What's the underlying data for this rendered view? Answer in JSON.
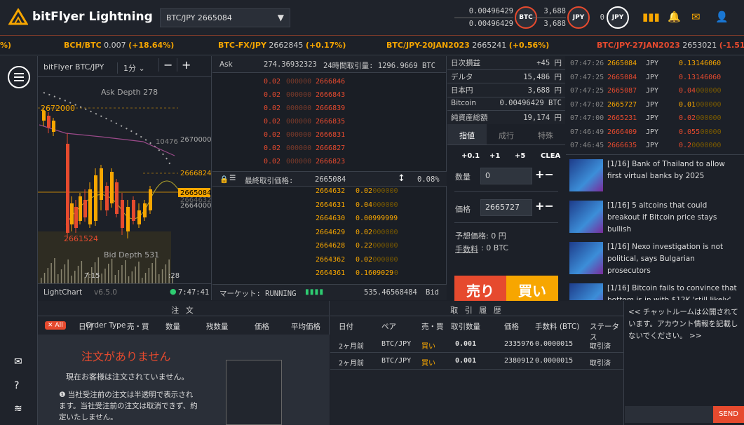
{
  "app": {
    "logo": "bitFlyer Lightning"
  },
  "header": {
    "pair_select": "BTC/JPY 2665084",
    "btc_bal_1": "0.00496429",
    "btc_bal_2": "0.00496429",
    "btc_label": "BTC",
    "jpy_bal_1": "3,688",
    "jpy_bal_2": "3,688",
    "jpy_label": "JPY",
    "jpy2_val": "0",
    "jpy2_label": "JPY"
  },
  "ticker": [
    {
      "symbol": "BCH/BTC",
      "price": "0.007",
      "change": "(+18.64%)",
      "dir": "up"
    },
    {
      "symbol": "BTC-FX/JPY",
      "price": "2662845",
      "change": "(+0.17%)",
      "dir": "up"
    },
    {
      "symbol": "BTC/JPY-20JAN2023",
      "price": "2665241",
      "change": "(+0.56%)",
      "dir": "up"
    },
    {
      "symbol": "BTC/JPY-27JAN2023",
      "price": "2653021",
      "change": "(-1.51%)",
      "dir": "dn"
    }
  ],
  "ticker_lead": "%)",
  "chart": {
    "pair": "bitFlyer BTC/JPY",
    "interval": "1分",
    "ask_depth": "Ask Depth 278",
    "bid_depth": "Bid Depth 531",
    "price_high": "2672000",
    "price_low": "2661524",
    "axis_1": "2670000",
    "axis_2": "2666824",
    "axis_3": "2665084",
    "axis_4": "2664000",
    "axis_4b": "2664632",
    "side_label": "10476",
    "time_label": "7:15",
    "time_label_2": ":28",
    "footer_brand": "LightChart",
    "footer_version": "v6.5.0",
    "footer_time": "7:47:41"
  },
  "book": {
    "ask_label": "Ask",
    "ask_total": "274.36932323",
    "volume_label": "24時間取引量: 1296.9669 BTC",
    "asks": [
      {
        "size": "0.02",
        "sizeb": "000000",
        "price": "2666846"
      },
      {
        "size": "0.02",
        "sizeb": "000000",
        "price": "2666843"
      },
      {
        "size": "0.02",
        "sizeb": "000000",
        "price": "2666839"
      },
      {
        "size": "0.02",
        "sizeb": "000000",
        "price": "2666835"
      },
      {
        "size": "0.02",
        "sizeb": "000000",
        "price": "2666831"
      },
      {
        "size": "0.02",
        "sizeb": "000000",
        "price": "2666827"
      },
      {
        "size": "0.02",
        "sizeb": "000000",
        "price": "2666823"
      }
    ],
    "last_label": "最終取引価格:",
    "last_price": "2665084",
    "spread": "0.08%",
    "bids": [
      {
        "price": "2664632",
        "size": "0.02",
        "sizeb": "000000"
      },
      {
        "price": "2664631",
        "size": "0.04",
        "sizeb": "000000"
      },
      {
        "price": "2664630",
        "size": "0.00999999",
        "sizeb": ""
      },
      {
        "price": "2664629",
        "size": "0.02",
        "sizeb": "000000"
      },
      {
        "price": "2664628",
        "size": "0.22",
        "sizeb": "000000"
      },
      {
        "price": "2664362",
        "size": "0.02",
        "sizeb": "000000"
      },
      {
        "price": "2664361",
        "size": "0.1609029",
        "sizeb": "0"
      }
    ],
    "market_label": "マーケット: RUNNING",
    "bid_total": "535.46568484",
    "bid_label": "Bid"
  },
  "account": [
    {
      "label": "日次損益",
      "value": "+45 円"
    },
    {
      "label": "デルタ",
      "value": "15,486 円"
    },
    {
      "label": "日本円",
      "value": "3,688 円"
    },
    {
      "label": "Bitcoin",
      "value": "0.00496429 BTC"
    },
    {
      "label": "純資産総額",
      "value": "19,174 円"
    }
  ],
  "order": {
    "tabs": [
      "指値",
      "成行",
      "特殊"
    ],
    "quick": [
      "+0.1",
      "+1",
      "+5",
      "CLEA"
    ],
    "qty_label": "数量",
    "qty_value": "0",
    "price_label": "価格",
    "price_value": "2665727",
    "est_label": "予想価格: 0 円",
    "fee_label": "手数料",
    "fee_value": ": 0 BTC",
    "sell": "売り",
    "buy": "買い"
  },
  "trades": [
    {
      "time": "07:47:26",
      "price": "2665084",
      "cur": "JPY",
      "size": "0.13146060",
      "sizeb": "",
      "side": "buy"
    },
    {
      "time": "07:47:25",
      "price": "2665084",
      "cur": "JPY",
      "size": "0.13146060",
      "sizeb": "",
      "side": "sell"
    },
    {
      "time": "07:47:25",
      "price": "2665087",
      "cur": "JPY",
      "size": "0.04",
      "sizeb": "000000",
      "side": "sell"
    },
    {
      "time": "07:47:02",
      "price": "2665727",
      "cur": "JPY",
      "size": "0.01",
      "sizeb": "000000",
      "side": "buy"
    },
    {
      "time": "07:47:00",
      "price": "2665231",
      "cur": "JPY",
      "size": "0.02",
      "sizeb": "000000",
      "side": "sell"
    },
    {
      "time": "07:46:49",
      "price": "2666409",
      "cur": "JPY",
      "size": "0.055",
      "sizeb": "00000",
      "side": "sell"
    },
    {
      "time": "07:46:45",
      "price": "2666635",
      "cur": "JPY",
      "size": "0.2",
      "sizeb": "0000000",
      "side": "sell"
    }
  ],
  "news": [
    {
      "text": "[1/16] Bank of Thailand to allow first virtual banks by 2025"
    },
    {
      "text": "[1/16] 5 altcoins that could breakout if Bitcoin price stays bullish"
    },
    {
      "text": "[1/16] Nexo investigation is not political, says Bulgarian prosecutors"
    },
    {
      "text": "[1/16] Bitcoin fails to convince that bottom is in with $12K 'still likely'"
    }
  ],
  "orders_panel": {
    "title": "注 文",
    "all_badge": "All",
    "cols": [
      "日付",
      "Order Type",
      "売・買",
      "数量",
      "残数量",
      "価格",
      "平均価格"
    ],
    "empty_title": "注文がありません",
    "empty_sub": "現在お客様は注文されていません。",
    "note": "当社受注前の注文は半透明で表示されます。当社受注前の注文は取消できず、約定いたしません。"
  },
  "history": {
    "title": "取 引 履 歴",
    "cols": [
      "日付",
      "ペア",
      "売・買",
      "取引数量",
      "価格",
      "手数料 (BTC)",
      "ステータス"
    ],
    "rows": [
      [
        "2ヶ月前",
        "BTC/JPY",
        "買い",
        "0.001",
        "2335976",
        "0.0000015",
        "取引済"
      ],
      [
        "2ヶ月前",
        "BTC/JPY",
        "買い",
        "0.001",
        "2380912",
        "0.0000015",
        "取引済"
      ]
    ]
  },
  "chat": {
    "notice": "<< チャットルームは公開されています。アカウント情報を記載しないでください。 >>",
    "send": "SEND"
  },
  "colors": {
    "accent": "#f7a600",
    "sell": "#e64a2e",
    "bg": "#1c2028"
  }
}
